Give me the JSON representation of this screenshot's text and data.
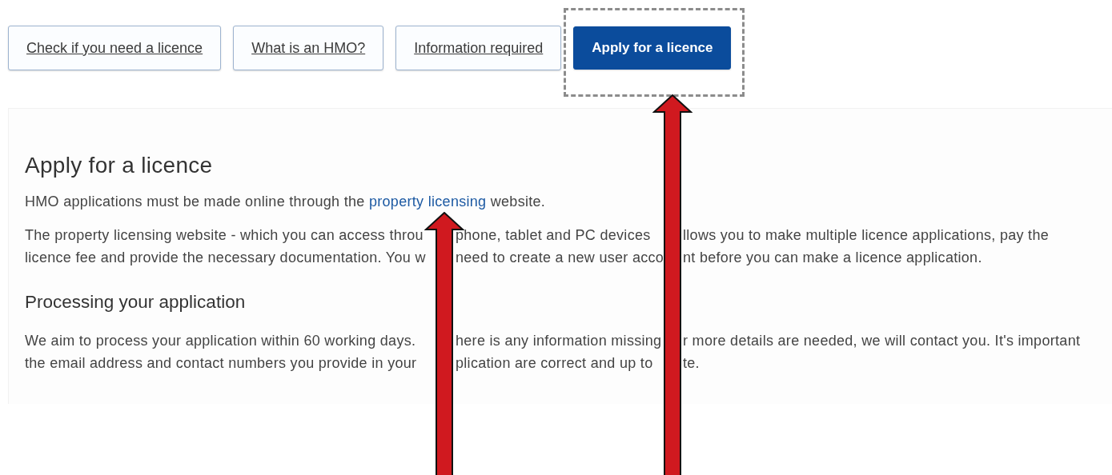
{
  "tabs": [
    {
      "label": "Check if you need a licence",
      "selected": false,
      "highlighted": false
    },
    {
      "label": "What is an HMO?",
      "selected": false,
      "highlighted": false
    },
    {
      "label": "Information required",
      "selected": false,
      "highlighted": false
    },
    {
      "label": "Apply for a licence",
      "selected": true,
      "highlighted": true
    }
  ],
  "content": {
    "title": "Apply for a licence",
    "intro": {
      "before": "HMO applications must be made online through the ",
      "link": "property licensing",
      "after": " website."
    },
    "paragraph": [
      [
        "The property licensing website - which you can access throu",
        "phone, tablet and PC devices",
        "llows you to make multiple licence applications, pay the"
      ],
      [
        "licence fee and provide the necessary documentation. You w",
        "need to create a new user acco",
        "nt before you can make a licence application."
      ]
    ],
    "subheading": "Processing your application",
    "processing": [
      [
        "We aim to process your application within 60 working days.",
        "here is any information missing",
        "r more details are needed, we will contact you. It's important"
      ],
      [
        "the email address and contact numbers you provide in your",
        "plication are correct and up to",
        "te."
      ]
    ]
  }
}
